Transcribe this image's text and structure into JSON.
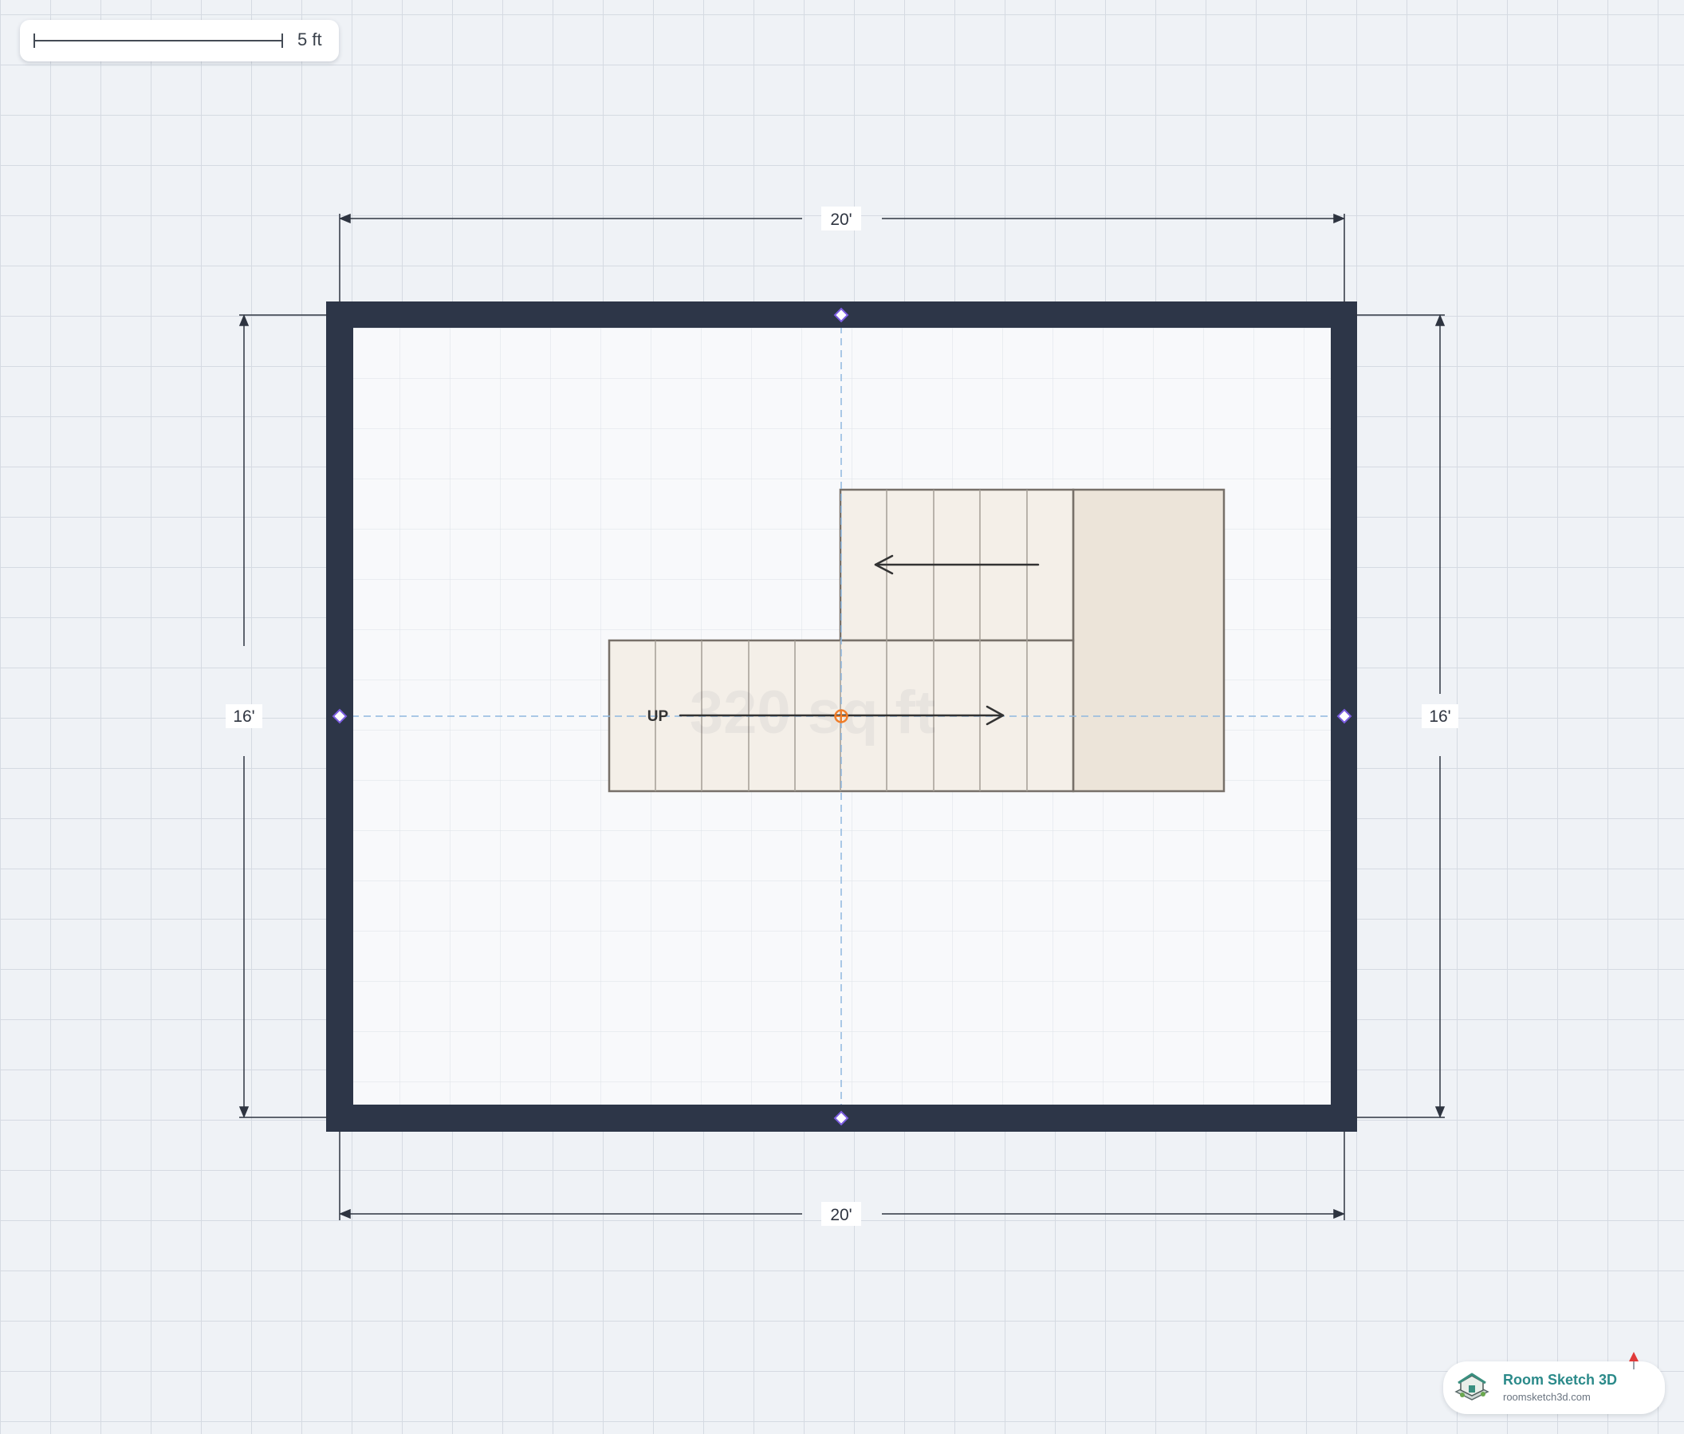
{
  "scale": {
    "label": "5 ft"
  },
  "room": {
    "width_label": "20'",
    "height_label": "16'",
    "area_label": "320 sq ft"
  },
  "stairs": {
    "direction_label": "UP"
  },
  "brand": {
    "name": "Room Sketch 3D",
    "url": "roomsketch3d.com",
    "colors": {
      "accent": "#2b8a8a",
      "wall": "#2d3648",
      "handle": "#7b5ce0",
      "center": "#f07d2a"
    }
  },
  "icons": [
    "house-logo-icon",
    "pin-icon",
    "arrow-left-icon",
    "arrow-right-icon"
  ]
}
